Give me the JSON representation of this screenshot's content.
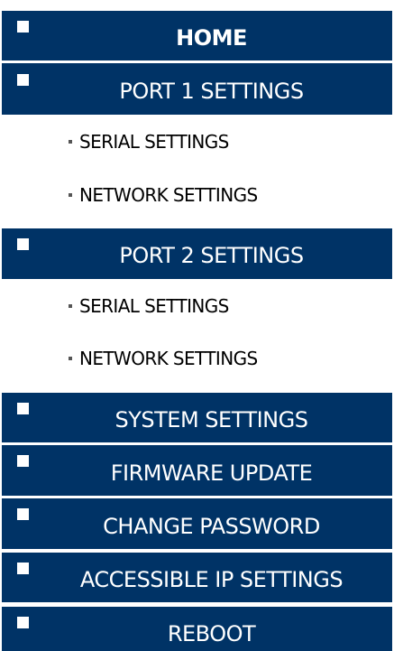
{
  "menu": {
    "home": "HOME",
    "port1": {
      "label": "PORT 1 SETTINGS",
      "sub": [
        "SERIAL SETTINGS",
        "NETWORK SETTINGS"
      ]
    },
    "port2": {
      "label": "PORT 2 SETTINGS",
      "sub": [
        "SERIAL SETTINGS",
        "NETWORK SETTINGS"
      ]
    },
    "system": "SYSTEM SETTINGS",
    "firmware": "FIRMWARE UPDATE",
    "password": "CHANGE PASSWORD",
    "accessible_ip": "ACCESSIBLE IP SETTINGS",
    "reboot": "REBOOT"
  },
  "colors": {
    "nav_background": "#003366",
    "nav_text": "#ffffff",
    "sub_text": "#000000"
  },
  "icons": {
    "menu_bullet": "white-square-icon",
    "submenu_bullet": "small-square-icon"
  }
}
